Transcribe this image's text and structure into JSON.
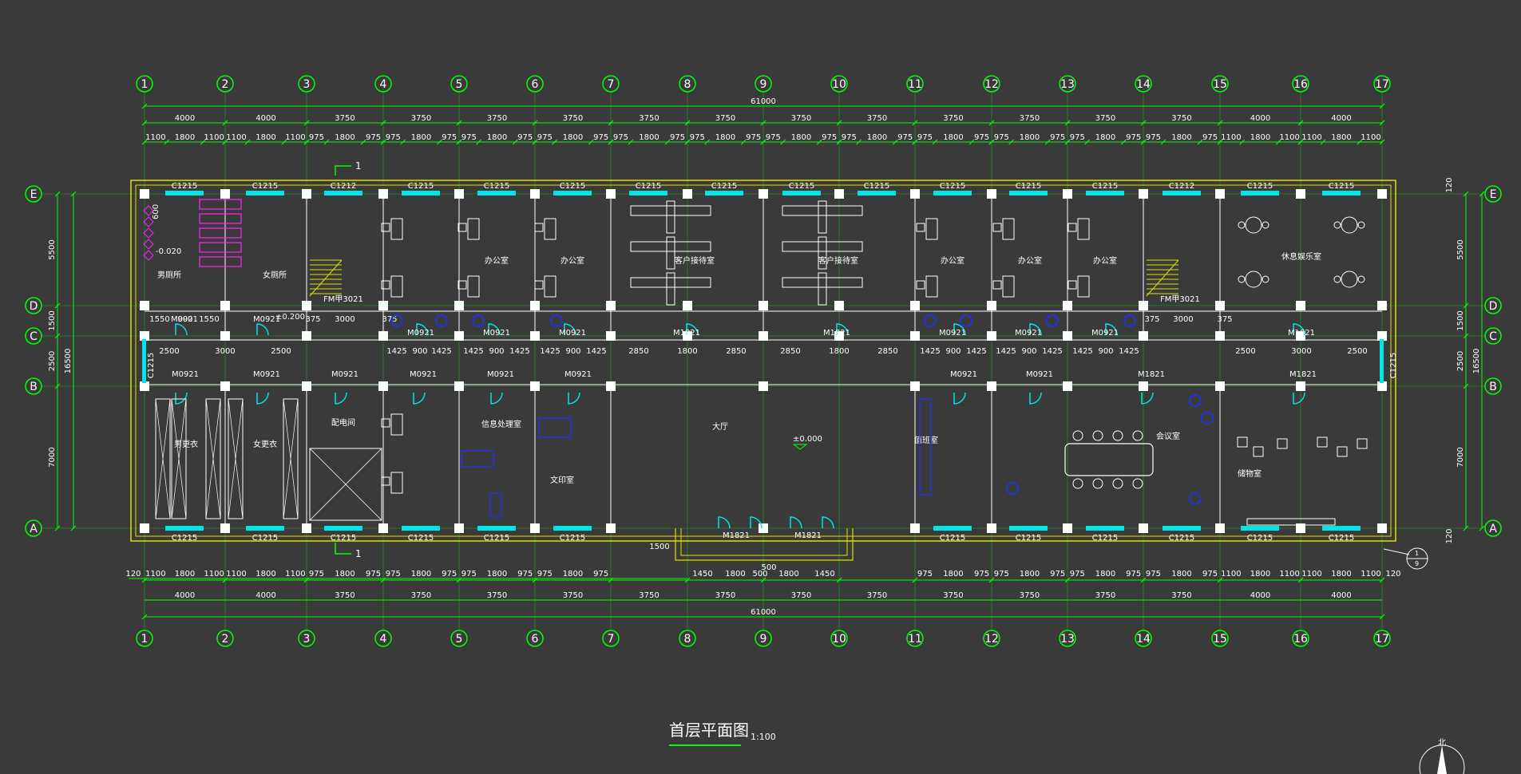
{
  "drawing": {
    "title": "首层平面图",
    "scale": "1:100",
    "north_label": "北",
    "section_mark": "1",
    "detail_mark_top": "1",
    "detail_mark_bottom": "9"
  },
  "axes": {
    "columns": [
      "1",
      "2",
      "3",
      "4",
      "5",
      "6",
      "7",
      "8",
      "9",
      "10",
      "11",
      "12",
      "13",
      "14",
      "15",
      "16",
      "17"
    ],
    "rows": [
      "E",
      "D",
      "C",
      "B",
      "A"
    ]
  },
  "dims_top": {
    "total": "61000",
    "row2": [
      "4000",
      "4000",
      "3750",
      "3750",
      "3750",
      "3750",
      "3750",
      "3750",
      "3750",
      "3750",
      "3750",
      "3750",
      "3750",
      "3750",
      "4000",
      "4000"
    ],
    "row3": [
      "1100",
      "1800",
      "1100",
      "1100",
      "1800",
      "1100",
      "975",
      "1800",
      "975",
      "975",
      "1800",
      "975",
      "975",
      "1800",
      "975",
      "975",
      "1800",
      "975",
      "975",
      "1800",
      "975",
      "975",
      "1800",
      "975",
      "975",
      "1800",
      "975",
      "975",
      "1800",
      "975",
      "975",
      "1800",
      "975",
      "975",
      "1800",
      "975",
      "975",
      "1800",
      "975",
      "975",
      "1800",
      "975",
      "1100",
      "1800",
      "1100",
      "1100",
      "1800",
      "1100"
    ]
  },
  "dims_bottom": {
    "total": "61000",
    "row2": [
      "4000",
      "4000",
      "3750",
      "3750",
      "3750",
      "3750",
      "3750",
      "3750",
      "3750",
      "3750",
      "3750",
      "3750",
      "3750",
      "3750",
      "4000",
      "4000"
    ],
    "row1_left": [
      "120",
      "1100",
      "1800",
      "1100",
      "1100",
      "1800",
      "1100",
      "975",
      "1800",
      "975",
      "975",
      "1800",
      "975",
      "975",
      "1800",
      "975",
      "975",
      "1800",
      "975"
    ],
    "row1_mid": [
      "1450",
      "1800",
      "500",
      "1800",
      "1450"
    ],
    "row1_right": [
      "975",
      "1800",
      "975",
      "975",
      "1800",
      "975",
      "975",
      "1800",
      "975",
      "975",
      "1800",
      "975",
      "1100",
      "1800",
      "1100",
      "1100",
      "1800",
      "1100",
      "120"
    ],
    "entry_depth": "1500",
    "entry_mid": "500"
  },
  "dims_left": {
    "total": "16500",
    "parts": [
      "5500",
      "1500",
      "2500",
      "7000"
    ],
    "edge": "120"
  },
  "dims_right": {
    "total": "16500",
    "parts": [
      "5500",
      "1500",
      "2500",
      "7000"
    ],
    "edge_top": "120",
    "edge_bottom": "120"
  },
  "corridor_dims": {
    "left_1": [
      "1550",
      "900",
      "1550"
    ],
    "left_2": [
      "2500",
      "3000",
      "2500"
    ],
    "stair": [
      "375",
      "3000",
      "375"
    ],
    "office_run": [
      "1425",
      "900",
      "1425",
      "1425",
      "900",
      "1425",
      "1425",
      "900",
      "1425"
    ],
    "hall": [
      "2850",
      "1800",
      "2850",
      "2850",
      "1800",
      "2850"
    ],
    "right_run": [
      "1425",
      "900",
      "1425",
      "1425",
      "900",
      "1425",
      "1425",
      "900",
      "1425"
    ],
    "stair_r": [
      "375",
      "3000",
      "375"
    ],
    "right_end": [
      "2500",
      "3000",
      "2500"
    ]
  },
  "windows_top": [
    "C1215",
    "C1215",
    "C1212",
    "C1215",
    "C1215",
    "C1215",
    "C1215",
    "C1215",
    "C1215",
    "C1215",
    "C1215",
    "C1215",
    "C1215",
    "C1212",
    "C1215",
    "C1215"
  ],
  "windows_bottom": [
    "C1215",
    "C1215",
    "C1215",
    "C1215",
    "C1215",
    "C1215",
    "C1215",
    "C1215",
    "C1215",
    "C1215",
    "C1215",
    "C1215"
  ],
  "window_side": "C1215",
  "doors": {
    "north_row": [
      "M0921",
      "M0921",
      "M0921",
      "M0921",
      "M1821",
      "M1821",
      "M0921",
      "M0921",
      "M0921",
      "M1821"
    ],
    "south_row": [
      "M0921",
      "M0921",
      "M0921",
      "M0921",
      "M0921",
      "M0921",
      "M0921",
      "M0921",
      "M1821",
      "M1821"
    ],
    "entry": [
      "M1821",
      "M1821"
    ],
    "fire_door": "FM甲3021"
  },
  "levels": {
    "ground": "±0.000",
    "wc": "-0.020",
    "stair": "±0.200",
    "wc_height": "600"
  },
  "rooms": {
    "mens_wc": "男厕所",
    "womens_wc": "女厕所",
    "office": "办公室",
    "reception": "客户接待室",
    "recreation": "休息娱乐室",
    "mens_locker": "男更衣",
    "womens_locker": "女更衣",
    "power": "配电间",
    "info": "信息处理室",
    "print": "文印室",
    "hall": "大厅",
    "duty": "值班室",
    "meeting": "会议室",
    "storage": "储物室"
  }
}
